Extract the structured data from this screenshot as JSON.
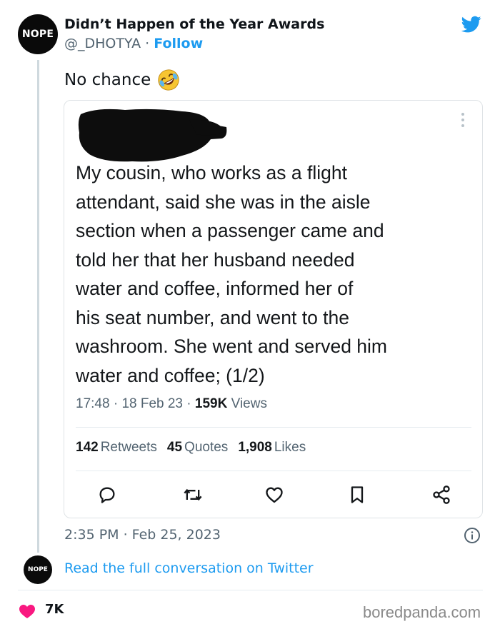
{
  "author": {
    "avatar_text": "NOPE",
    "name": "Didn’t Happen of the Year Awards",
    "handle": "@_DHOTYA",
    "separator": " · ",
    "follow_label": "Follow"
  },
  "tweet": {
    "text": "No chance"
  },
  "quoted_tweet": {
    "lines": [
      "My cousin, who works as a flight",
      "attendant, said she was in the aisle",
      "section when a passenger came and",
      "told her that her husband needed",
      "water and coffee, informed her of",
      "his seat number, and went to the",
      "washroom. She went and served him",
      "water and coffee; (1/2)"
    ],
    "time": "17:48",
    "dot": " · ",
    "date": "18 Feb 23",
    "views_count": "159K",
    "views_label": "Views",
    "retweets_count": "142",
    "retweets_label": "Retweets",
    "quotes_count": "45",
    "quotes_label": "Quotes",
    "likes_count": "1,908",
    "likes_label": "Likes"
  },
  "timestamp": "2:35 PM · Feb 25, 2023",
  "read_link": "Read the full conversation on Twitter",
  "footer": {
    "avatar_text": "NOPE",
    "like_count": "7K",
    "watermark": "boredpanda.com"
  },
  "colors": {
    "twitter_blue": "#1d9bf0",
    "heart_red": "#f91880",
    "text_gray": "#536471"
  }
}
